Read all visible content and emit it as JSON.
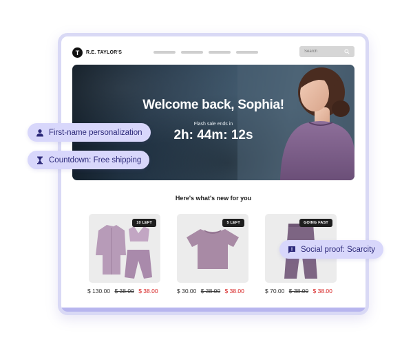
{
  "header": {
    "logo_mark": "T",
    "logo_text": "R.E. TAYLOR'S",
    "nav_items": [
      "",
      "",
      "",
      ""
    ],
    "search_placeholder": "Search"
  },
  "hero": {
    "title": "Welcome back, Sophia!",
    "subtitle": "Flash sale ends in",
    "timer": "2h: 44m: 12s"
  },
  "section": {
    "title": "Here's what's new for you"
  },
  "products": [
    {
      "badge": "10 LEFT",
      "price": "$ 130.00",
      "old_price": "$ 38.00",
      "sale_price": "$ 38.00",
      "color": "#b79bb8"
    },
    {
      "badge": "5 LEFT",
      "price": "$ 30.00",
      "old_price": "$ 38.00",
      "sale_price": "$ 38.00",
      "color": "#a88aa5"
    },
    {
      "badge": "GOING FAST",
      "price": "$ 70.00",
      "old_price": "$ 38.00",
      "sale_price": "$ 38.00",
      "color": "#7d6583"
    }
  ],
  "annotations": [
    {
      "label": "First-name personalization",
      "icon": "person-icon"
    },
    {
      "label": "Countdown: Free shipping",
      "icon": "hourglass-icon"
    },
    {
      "label": "Social proof: Scarcity",
      "icon": "alert-message-icon"
    }
  ],
  "colors": {
    "frame_border": "#d9d9f5",
    "pill_bg": "#d8d7fb",
    "pill_text": "#2d2a7a",
    "sale_red": "#d61f1f",
    "hero_bg": "#25384a"
  }
}
